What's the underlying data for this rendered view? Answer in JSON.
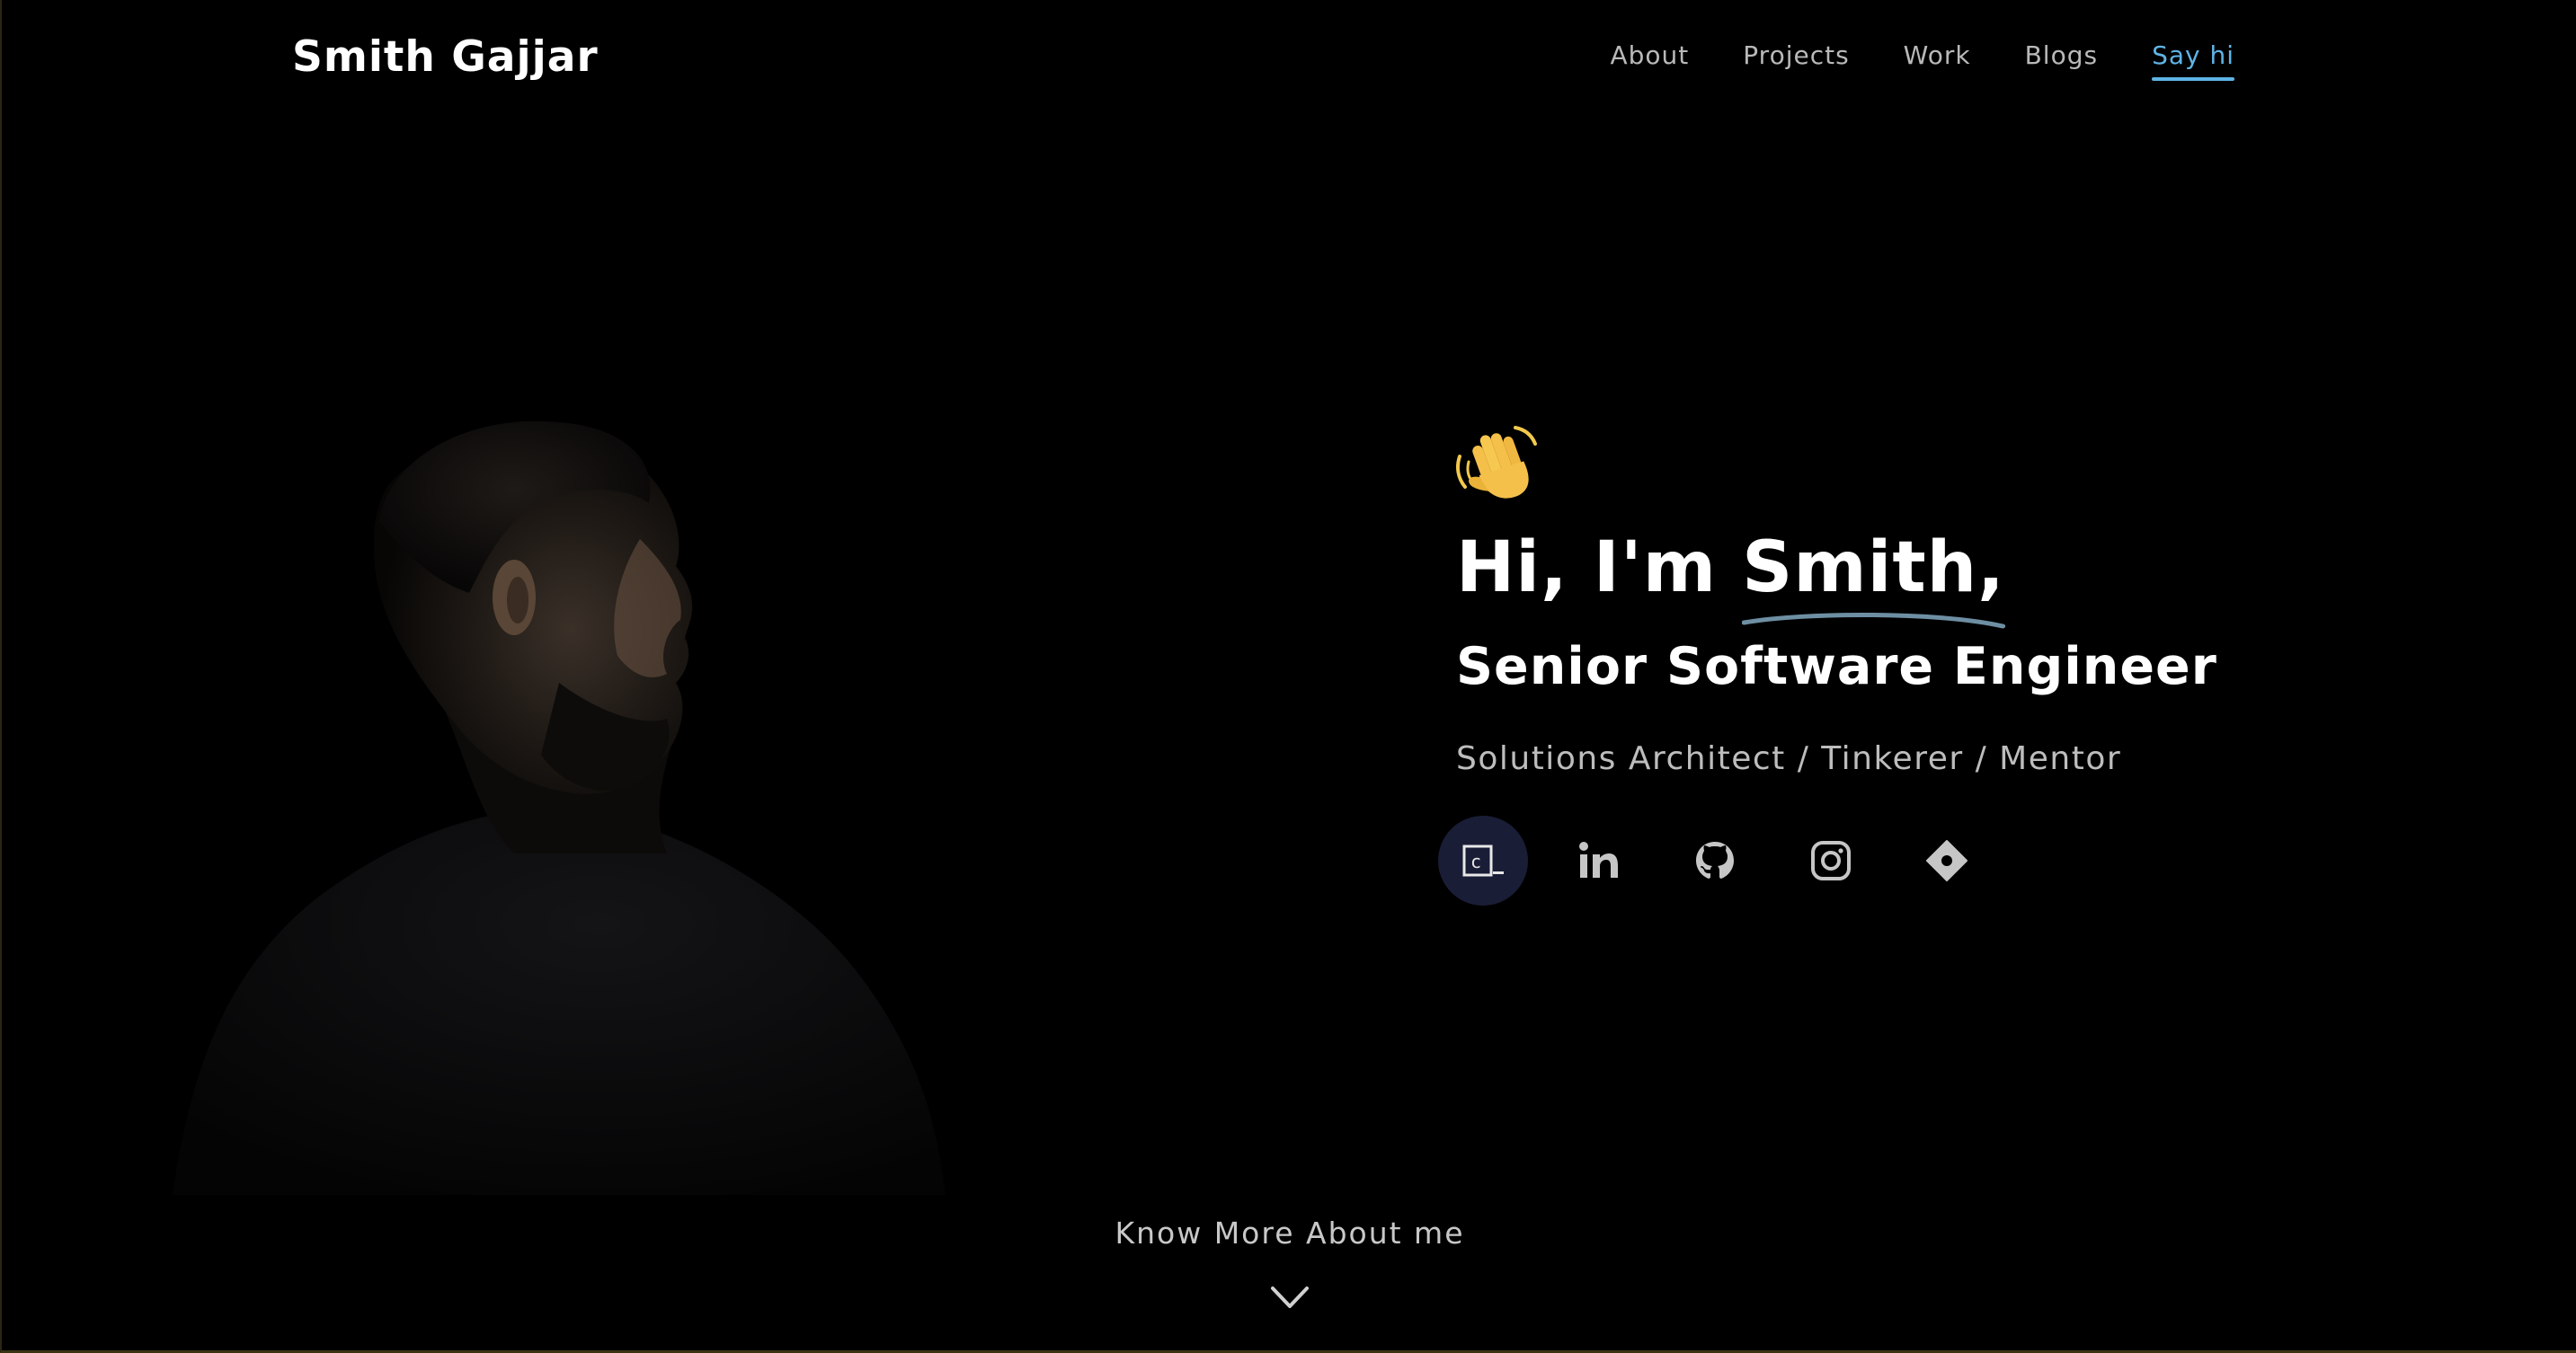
{
  "header": {
    "brand": "Smith Gajjar",
    "nav": [
      {
        "label": "About"
      },
      {
        "label": "Projects"
      },
      {
        "label": "Work"
      },
      {
        "label": "Blogs"
      },
      {
        "label": "Say hi",
        "active": true
      }
    ]
  },
  "hero": {
    "emoji": "waving-hand",
    "greeting_prefix": "Hi, I'm ",
    "greeting_name": "Smith,",
    "role": "Senior Software Engineer",
    "tagline": "Solutions Architect / Tinkerer / Mentor",
    "socials": [
      {
        "icon": "terminal-icon",
        "active": true
      },
      {
        "icon": "linkedin-icon"
      },
      {
        "icon": "github-icon"
      },
      {
        "icon": "instagram-icon"
      },
      {
        "icon": "diamond-icon"
      }
    ]
  },
  "footer_cta": {
    "label": "Know More About me",
    "icon": "chevron-down-icon"
  },
  "colors": {
    "background": "#000000",
    "accent": "#5fb4e6",
    "underline": "#6e8fa3",
    "active_social_bg": "#1a1d36",
    "muted_text": "#bdbdbd"
  }
}
